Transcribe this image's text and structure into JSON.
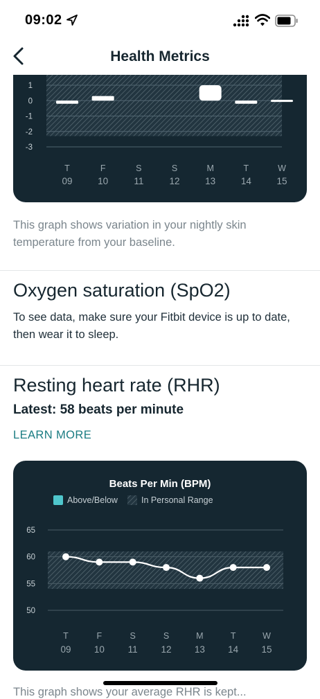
{
  "status_bar": {
    "time": "09:02",
    "icons": [
      "location-arrow-icon",
      "signal-icon",
      "wifi-icon",
      "battery-icon"
    ]
  },
  "nav": {
    "title": "Health Metrics",
    "back_icon": "chevron-left-icon"
  },
  "skin_temp": {
    "description": "This graph shows variation in your nightly skin temperature from your baseline.",
    "chart_data": {
      "type": "bar",
      "yticks": [
        "1",
        "0",
        "-1",
        "-2",
        "-3"
      ],
      "ylim": [
        -3,
        1
      ],
      "personal_range": [
        -2.3,
        1.1
      ],
      "days": [
        "T",
        "F",
        "S",
        "S",
        "M",
        "T",
        "W"
      ],
      "dates": [
        "09",
        "10",
        "11",
        "12",
        "13",
        "14",
        "15"
      ],
      "values": [
        -0.2,
        0.3,
        null,
        null,
        1.0,
        -0.2,
        0.05
      ],
      "colors": {
        "card": "#152731",
        "bar": "#ffffff",
        "text": "#9aa7ae"
      }
    }
  },
  "spo2": {
    "title": "Oxygen saturation (SpO2)",
    "body": "To see data, make sure your Fitbit device is up to date, then wear it to sleep."
  },
  "rhr": {
    "title": "Resting heart rate (RHR)",
    "latest": "Latest: 58 beats per minute",
    "learn_more": "LEARN MORE",
    "chart_data": {
      "type": "line",
      "title": "Beats Per Min (BPM)",
      "legend": [
        {
          "label": "Above/Below",
          "swatch": "#4fc6cc"
        },
        {
          "label": "In Personal Range",
          "swatch": "hatch"
        }
      ],
      "yticks": [
        "65",
        "60",
        "55",
        "50"
      ],
      "ylim": [
        50,
        65
      ],
      "personal_range": [
        54,
        61
      ],
      "days": [
        "T",
        "F",
        "S",
        "S",
        "M",
        "T",
        "W"
      ],
      "dates": [
        "09",
        "10",
        "11",
        "12",
        "13",
        "14",
        "15"
      ],
      "values": [
        60,
        59,
        59,
        58,
        56,
        58,
        58
      ],
      "colors": {
        "line": "#ffffff",
        "grid": "#4a5c66"
      }
    }
  },
  "footer_peek": "This graph shows your average RHR is kept..."
}
